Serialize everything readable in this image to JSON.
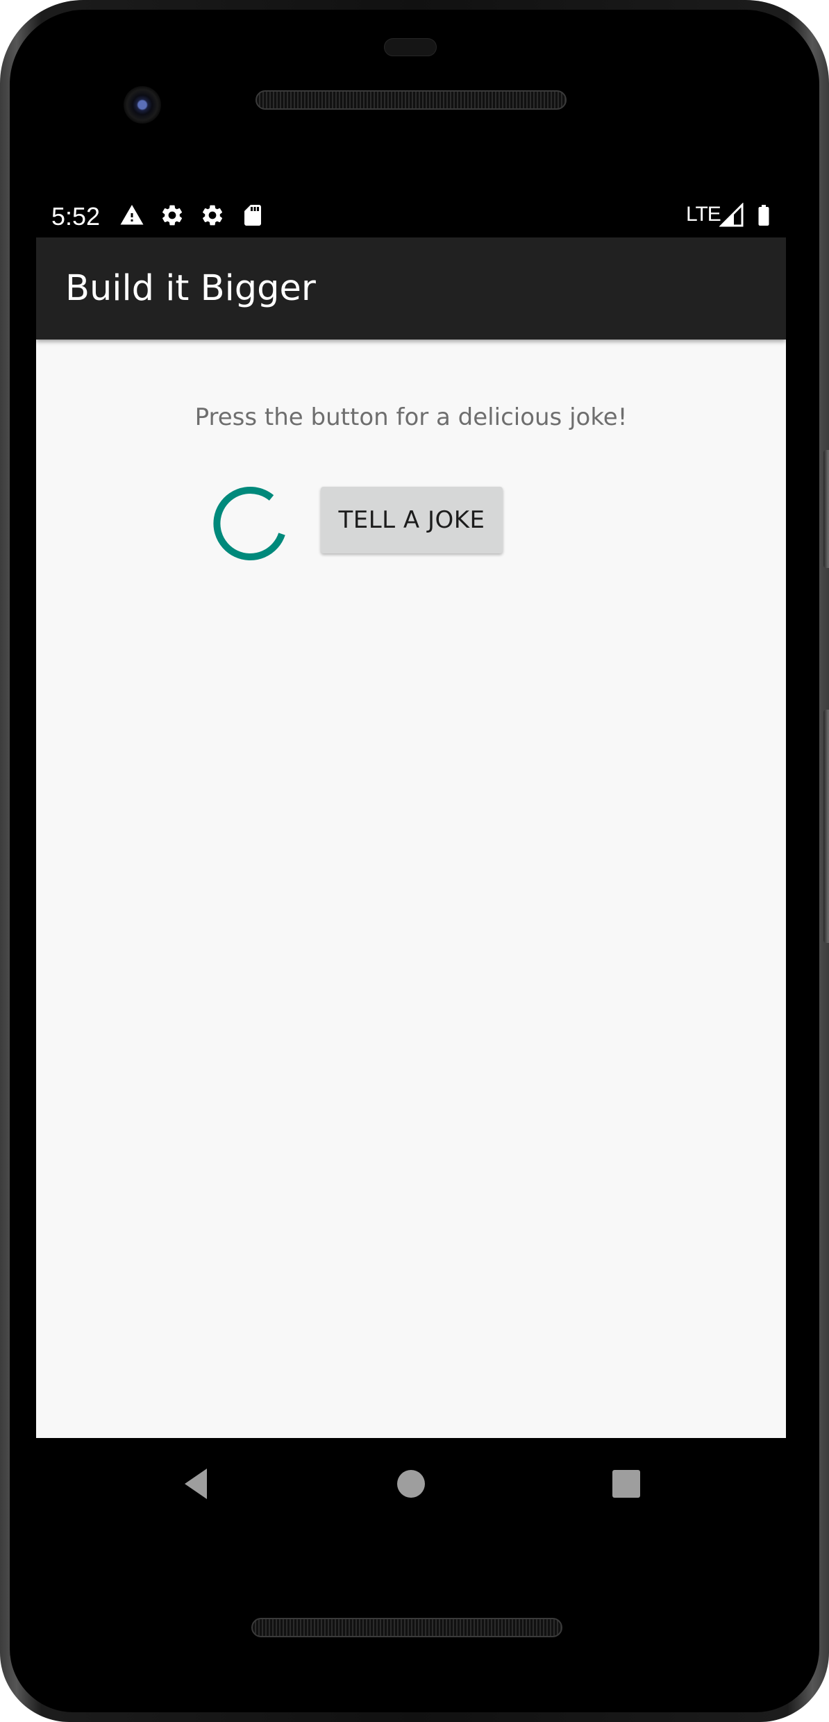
{
  "status_bar": {
    "time": "5:52",
    "network": "LTE",
    "icons": [
      "warning-icon",
      "settings-gear-icon",
      "settings-gear-icon",
      "sd-card-icon",
      "signal-icon",
      "battery-icon"
    ]
  },
  "app_bar": {
    "title": "Build it Bigger"
  },
  "main": {
    "instructions": "Press the button for a delicious joke!",
    "button_label": "TELL A JOKE",
    "spinner_color": "#00897b"
  },
  "nav_bar": {
    "icons": [
      "back-triangle-icon",
      "home-circle-icon",
      "recents-square-icon"
    ]
  },
  "colors": {
    "app_bar": "#212121",
    "content_bg": "#f8f8f8",
    "button_bg": "#d6d7d7",
    "text_secondary": "#6e6e6e",
    "accent": "#00897b"
  }
}
